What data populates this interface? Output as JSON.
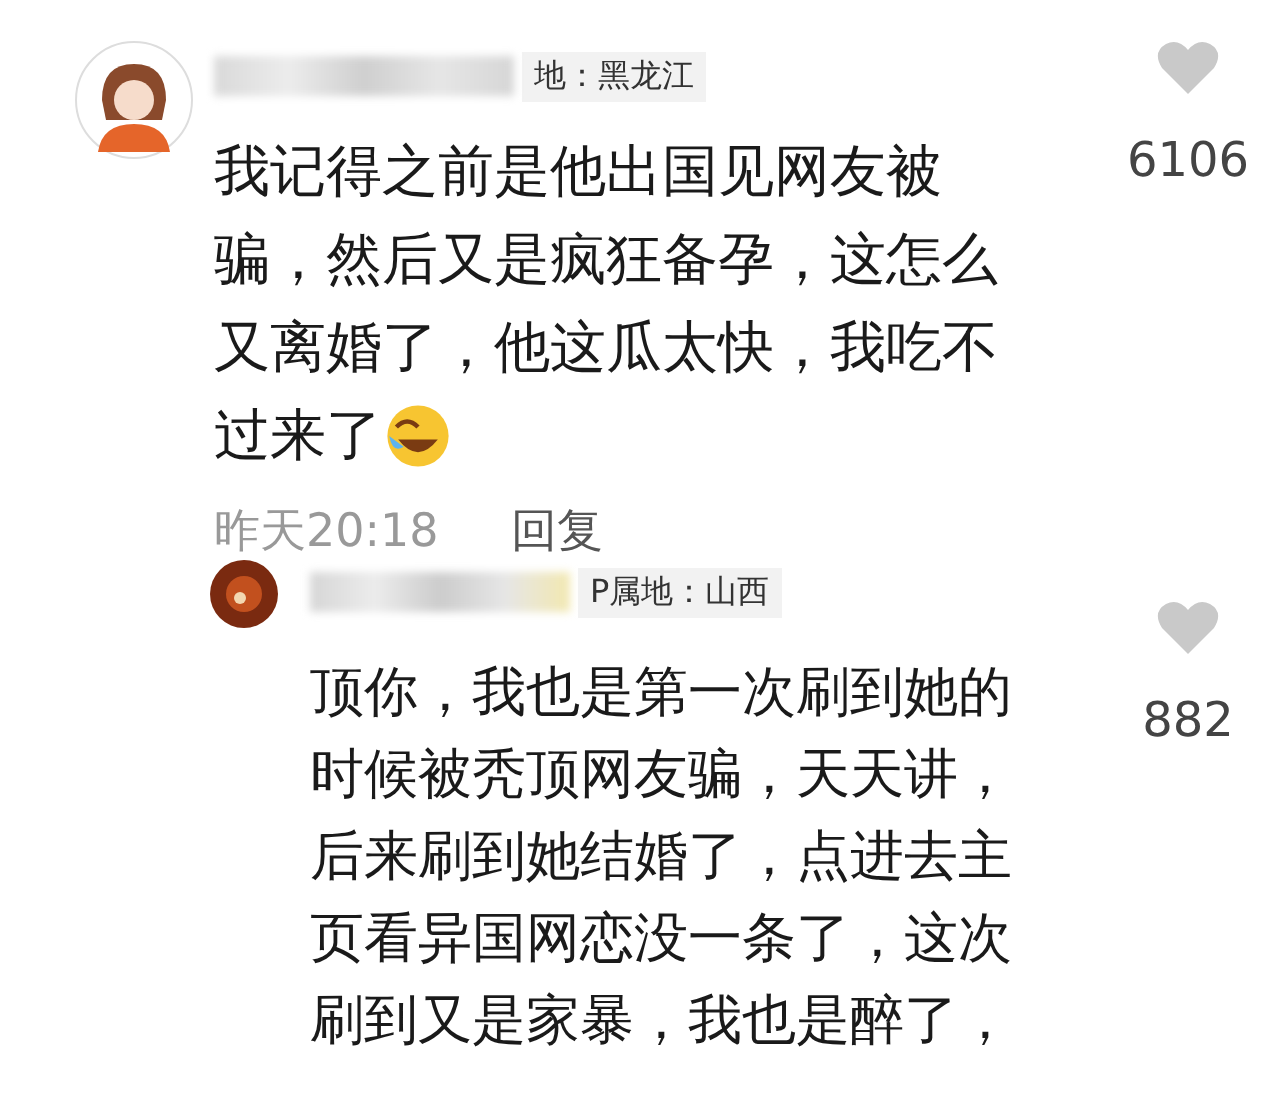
{
  "comments": [
    {
      "location": "地：黑龙江",
      "lines": [
        "我记得之前是他出国见网友被",
        "骗，然后又是疯狂备孕，这怎么",
        "又离婚了，他这瓜太快，我吃不",
        "过来了"
      ],
      "emoji": true,
      "likes": "6106",
      "time": "昨天20:18",
      "reply": "回复",
      "kind": "top"
    },
    {
      "location": "P属地：山西",
      "lines": [
        "顶你，我也是第一次刷到她的",
        "时候被秃顶网友骗，天天讲，",
        "后来刷到她结婚了，点进去主",
        "页看异国网恋没一条了，这次",
        "刷到又是家暴，我也是醉了，"
      ],
      "emoji": false,
      "likes": "882",
      "kind": "reply"
    }
  ]
}
